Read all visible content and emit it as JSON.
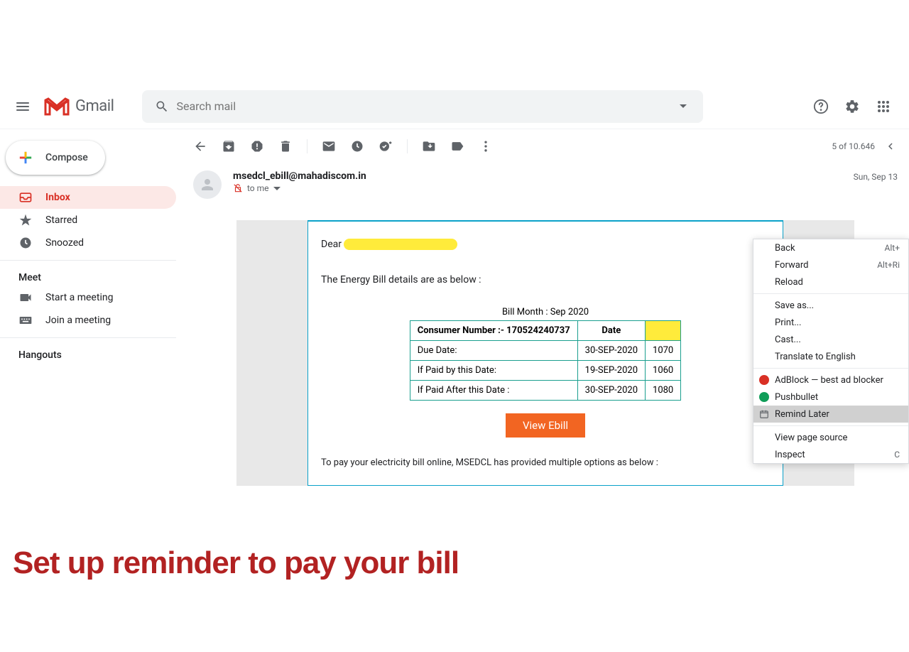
{
  "header": {
    "product": "Gmail",
    "search_placeholder": "Search mail"
  },
  "compose_label": "Compose",
  "sidebar": {
    "items": [
      {
        "label": "Inbox"
      },
      {
        "label": "Starred"
      },
      {
        "label": "Snoozed"
      }
    ],
    "meet_title": "Meet",
    "meet": [
      {
        "label": "Start a meeting"
      },
      {
        "label": "Join a meeting"
      }
    ],
    "hangouts_title": "Hangouts"
  },
  "toolbar": {
    "pager": "5 of 10.646"
  },
  "email": {
    "from": "msedcl_ebill@mahadiscom.in",
    "to_label": "to me",
    "date": "Sun, Sep 13",
    "salutation_prefix": "Dear",
    "subline": "The Energy Bill details are as below :",
    "bill_month_label": "Bill Month : Sep 2020",
    "table": {
      "h1": "Consumer Number :-  170524240737",
      "h2": "Date",
      "r1c1": "Due Date:",
      "r1c2": "30-SEP-2020",
      "r1c3": "1070",
      "r2c1": "If Paid by this Date:",
      "r2c2": "19-SEP-2020",
      "r2c3": "1060",
      "r3c1": "If Paid After this Date :",
      "r3c2": "30-SEP-2020",
      "r3c3": "1080"
    },
    "view_btn": "View Ebill",
    "foot_note": "To pay your electricity bill online, MSEDCL has provided multiple options as below :"
  },
  "ctx": {
    "back": "Back",
    "back_key": "Alt+",
    "forward": "Forward",
    "forward_key": "Alt+Ri",
    "reload": "Reload",
    "save_as": "Save as...",
    "print": "Print...",
    "cast": "Cast...",
    "translate": "Translate to English",
    "adblock": "AdBlock — best ad blocker",
    "pushbullet": "Pushbullet",
    "remind_later": "Remind Later",
    "view_source": "View page source",
    "inspect": "Inspect",
    "inspect_key": "C"
  },
  "annotation": "Set up reminder to pay your bill",
  "colors": {
    "opera_red": "#d93025",
    "green": "#0f9d58"
  }
}
